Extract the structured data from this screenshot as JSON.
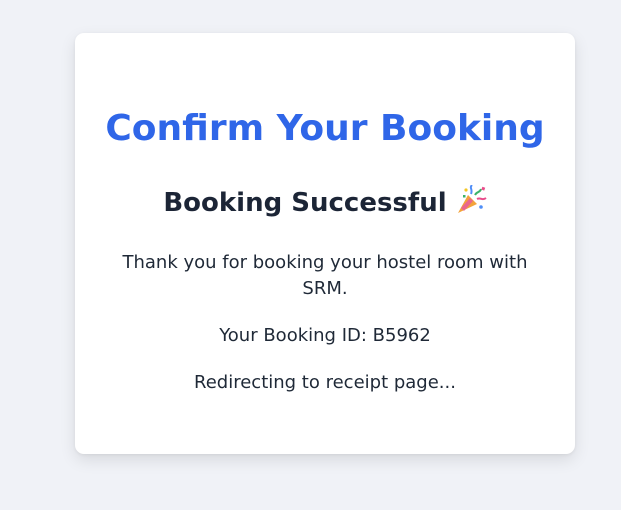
{
  "card": {
    "title": "Confirm Your Booking",
    "subtitle": "Booking Successful",
    "subtitle_icon": "party-popper-icon",
    "thanks_text": "Thank you for booking your hostel room with SRM.",
    "booking_id_text": "Your Booking ID: B5962",
    "redirect_text": "Redirecting to receipt page..."
  },
  "colors": {
    "background": "#f0f2f7",
    "card": "#ffffff",
    "title": "#2f66e8",
    "text": "#1f2937"
  }
}
